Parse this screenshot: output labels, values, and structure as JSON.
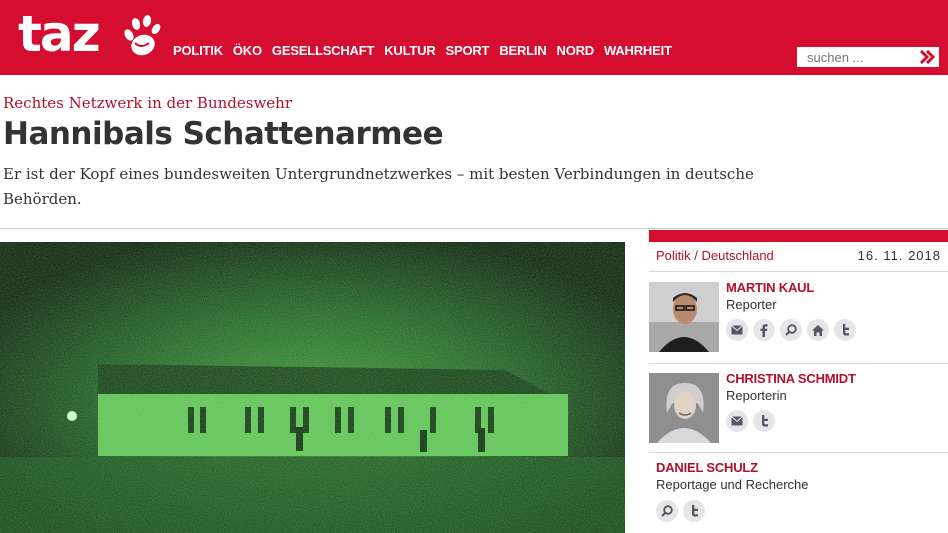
{
  "brand": {
    "logo": "taz",
    "color": "#d50d2e",
    "accent_text": "#b0122b"
  },
  "nav": {
    "items": [
      {
        "label": "POLITIK",
        "active": true
      },
      {
        "label": "ÖKO"
      },
      {
        "label": "GESELLSCHAFT"
      },
      {
        "label": "KULTUR"
      },
      {
        "label": "SPORT"
      },
      {
        "label": "BERLIN"
      },
      {
        "label": "NORD"
      },
      {
        "label": "WAHRHEIT"
      }
    ]
  },
  "search": {
    "placeholder": "suchen ...",
    "go_icon": "double-chevron-right-icon"
  },
  "article": {
    "kicker": "Rechtes Netzwerk in der Bundeswehr",
    "title": "Hannibals Schattenarmee",
    "lead": "Er ist der Kopf eines bundesweiten Untergrundnetzwerkes – mit besten Verbindungen in deutsche Behörden."
  },
  "sidebar": {
    "section": "Politik / Deutschland",
    "date": "16. 11. 2018",
    "authors": [
      {
        "name": "MARTIN KAUL",
        "role": "Reporter",
        "icons": [
          "mail-icon",
          "facebook-icon",
          "search-icon",
          "home-icon",
          "twitter-icon"
        ]
      },
      {
        "name": "CHRISTINA SCHMIDT",
        "role": "Reporterin",
        "icons": [
          "mail-icon",
          "twitter-icon"
        ]
      },
      {
        "name": "DANIEL SCHULZ",
        "role": "Reportage und Recherche",
        "icons": [
          "search-icon",
          "twitter-icon"
        ]
      }
    ]
  }
}
